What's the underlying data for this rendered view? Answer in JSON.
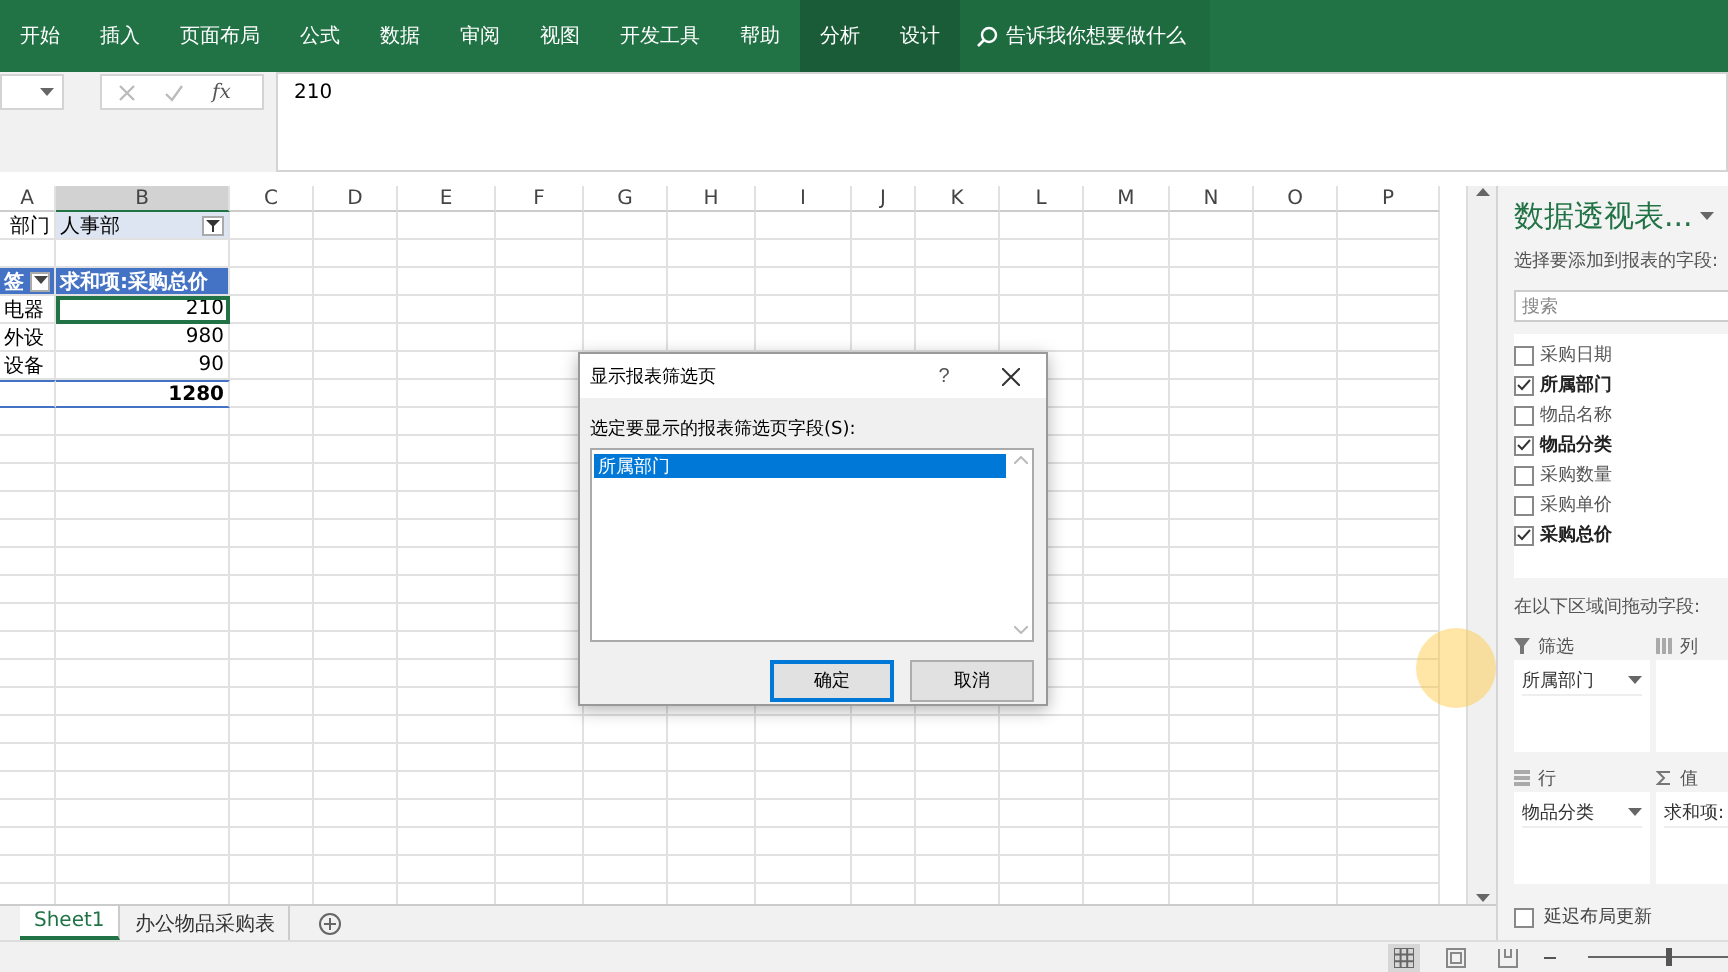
{
  "ribbon": {
    "tabs": [
      {
        "label": "开始",
        "kind": "standard"
      },
      {
        "label": "插入",
        "kind": "standard"
      },
      {
        "label": "页面布局",
        "kind": "standard"
      },
      {
        "label": "公式",
        "kind": "standard"
      },
      {
        "label": "数据",
        "kind": "standard"
      },
      {
        "label": "审阅",
        "kind": "standard"
      },
      {
        "label": "视图",
        "kind": "standard"
      },
      {
        "label": "开发工具",
        "kind": "standard"
      },
      {
        "label": "帮助",
        "kind": "standard"
      },
      {
        "label": "分析",
        "kind": "contextual"
      },
      {
        "label": "设计",
        "kind": "contextual"
      }
    ],
    "search": {
      "placeholder": "告诉我你想要做什么"
    }
  },
  "formula_bar": {
    "function_label": "fx",
    "value": "210"
  },
  "columns": [
    {
      "label": "A",
      "selected": false
    },
    {
      "label": "B",
      "selected": true
    },
    {
      "label": "C",
      "selected": false
    },
    {
      "label": "D",
      "selected": false
    },
    {
      "label": "E",
      "selected": false
    },
    {
      "label": "F",
      "selected": false
    },
    {
      "label": "G",
      "selected": false
    },
    {
      "label": "H",
      "selected": false
    },
    {
      "label": "I",
      "selected": false
    },
    {
      "label": "J",
      "selected": false
    },
    {
      "label": "K",
      "selected": false
    },
    {
      "label": "L",
      "selected": false
    },
    {
      "label": "M",
      "selected": false
    },
    {
      "label": "N",
      "selected": false
    },
    {
      "label": "O",
      "selected": false
    },
    {
      "label": "P",
      "selected": false
    }
  ],
  "pivot_filter": {
    "label": "部门",
    "value": "人事部"
  },
  "pivot_table": {
    "row_label": "签",
    "value_header": "求和项:采购总价",
    "rows": [
      {
        "label": "电器",
        "value": "210",
        "selected": true
      },
      {
        "label": "外设",
        "value": "980",
        "selected": false
      },
      {
        "label": "设备",
        "value": "90",
        "selected": false
      }
    ],
    "total": "1280"
  },
  "dialog": {
    "title": "显示报表筛选页",
    "help": "?",
    "prompt": "选定要显示的报表筛选页字段(S):",
    "items": [
      {
        "label": "所属部门",
        "selected": true
      }
    ],
    "buttons": [
      {
        "label": "确定",
        "kind": "primary"
      },
      {
        "label": "取消",
        "kind": "secondary"
      }
    ]
  },
  "field_panel": {
    "title": "数据透视表...",
    "subtitle": "选择要添加到报表的字段:",
    "search": {
      "placeholder": "搜索"
    },
    "fields": [
      {
        "label": "采购日期",
        "checked": false
      },
      {
        "label": "所属部门",
        "checked": true
      },
      {
        "label": "物品名称",
        "checked": false
      },
      {
        "label": "物品分类",
        "checked": true
      },
      {
        "label": "采购数量",
        "checked": false
      },
      {
        "label": "采购单价",
        "checked": false
      },
      {
        "label": "采购总价",
        "checked": true
      }
    ],
    "areas_hint": "在以下区域间拖动字段:",
    "areas": [
      {
        "kind": "filter",
        "label": "筛选",
        "items": [
          "所属部门"
        ]
      },
      {
        "kind": "columns",
        "label": "列"
      },
      {
        "kind": "rows",
        "label": "行",
        "items": [
          "物品分类"
        ]
      },
      {
        "kind": "values",
        "label": "值",
        "items": [
          "求和项:"
        ]
      }
    ],
    "defer_update": {
      "label": "延迟布局更新",
      "checked": false
    }
  },
  "sheet_tabs": [
    {
      "label": "Sheet1",
      "selected": true
    },
    {
      "label": "办公物品采购表",
      "selected": false
    }
  ],
  "status_bar": {
    "zoom": {
      "level": 0.55
    }
  }
}
